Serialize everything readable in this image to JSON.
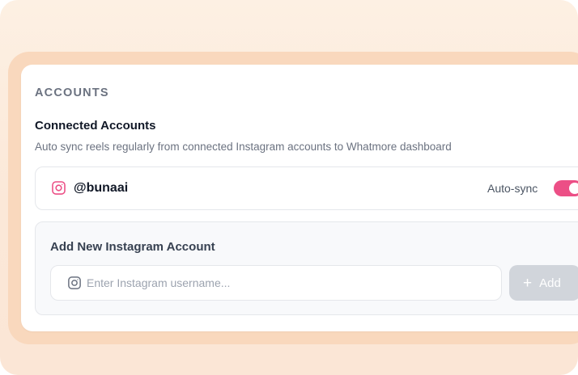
{
  "section": {
    "title": "ACCOUNTS"
  },
  "connected": {
    "heading": "Connected Accounts",
    "description": "Auto sync reels regularly from connected Instagram accounts to Whatmore dashboard",
    "accounts": [
      {
        "handle": "@bunaai",
        "icon": "instagram-icon",
        "autosync_label": "Auto-sync",
        "autosync_on": true
      }
    ]
  },
  "add_account": {
    "title": "Add New Instagram Account",
    "input_value": "",
    "input_placeholder": "Enter Instagram username...",
    "button_label": "Add",
    "button_icon": "plus-icon"
  },
  "colors": {
    "accent": "#ec4f86",
    "frame": "#f9d8bd",
    "disabled_button": "#d1d5db"
  }
}
